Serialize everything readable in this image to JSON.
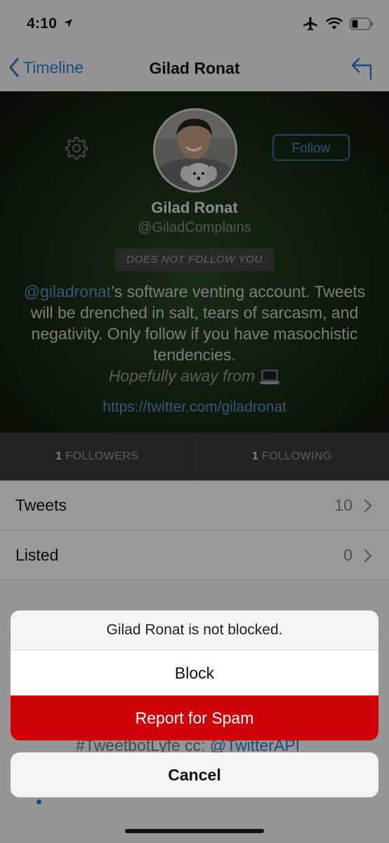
{
  "status_bar": {
    "time": "4:10"
  },
  "nav": {
    "back_label": "Timeline",
    "title": "Gilad Ronat"
  },
  "profile": {
    "follow_label": "Follow",
    "name": "Gilad Ronat",
    "handle": "@GiladComplains",
    "badge": "DOES NOT FOLLOW YOU",
    "bio_mention": "@giladronat",
    "bio_rest": "’s software venting account. Tweets will be drenched in salt, tears of sarcasm, and negativity. Only follow if you have masochistic tendencies.",
    "bio_italic": "Hopefully away from",
    "url": "https://twitter.com/giladronat"
  },
  "stats": {
    "followers_count": "1",
    "followers_label": "FOLLOWERS",
    "following_count": "1",
    "following_label": "FOLLOWING"
  },
  "list": [
    {
      "label": "Tweets",
      "value": "10"
    },
    {
      "label": "Listed",
      "value": "0"
    }
  ],
  "background_tweet": {
    "text": "#TweetbotLyfe cc: ",
    "mention": "@TwitterAPI"
  },
  "action_sheet": {
    "message": "Gilad Ronat is not blocked.",
    "block_label": "Block",
    "spam_label": "Report for Spam",
    "cancel_label": "Cancel"
  },
  "colors": {
    "accent": "#2f7bd6",
    "danger": "#d0030a"
  }
}
